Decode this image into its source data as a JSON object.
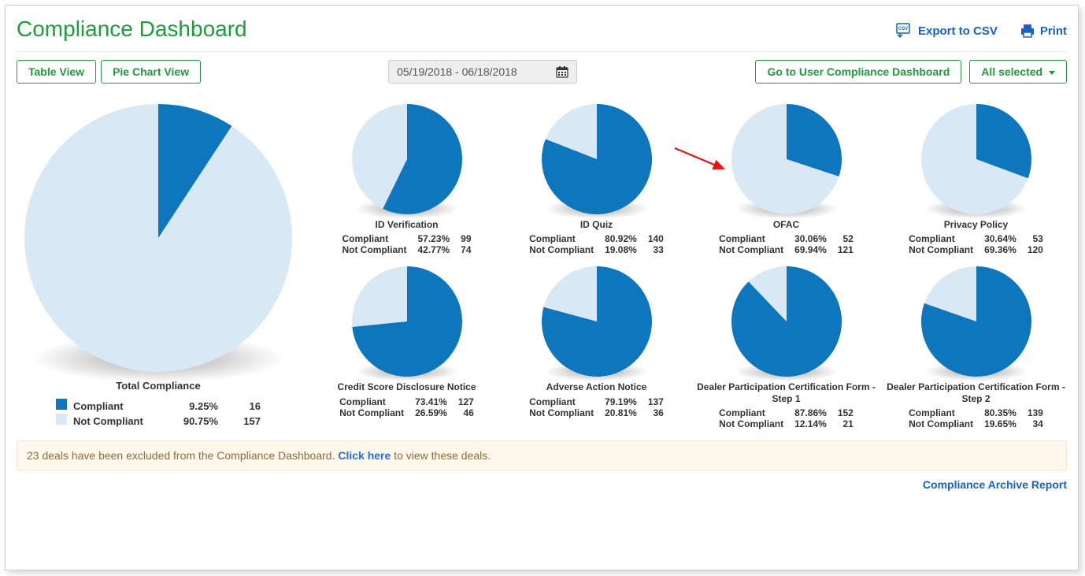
{
  "colors": {
    "compliant": "#0e76bc",
    "not_compliant": "#d8e9f5",
    "green": "#1b9e3a",
    "link": "#1862c6"
  },
  "header": {
    "title": "Compliance Dashboard",
    "export_csv": "Export to CSV",
    "print": "Print"
  },
  "controls": {
    "table_view": "Table View",
    "pie_chart_view": "Pie Chart View",
    "date_range": "05/19/2018 - 06/18/2018",
    "user_dashboard": "Go to User Compliance Dashboard",
    "all_selected": "All selected"
  },
  "legend": {
    "compliant": "Compliant",
    "not_compliant": "Not Compliant"
  },
  "total": {
    "title": "Total Compliance",
    "compliant_pct": "9.25%",
    "compliant_n": "16",
    "not_pct": "90.75%",
    "not_n": "157"
  },
  "cards": [
    {
      "title": "ID Verification",
      "compliant_pct": "57.23%",
      "compliant_n": "99",
      "not_pct": "42.77%",
      "not_n": "74"
    },
    {
      "title": "ID Quiz",
      "compliant_pct": "80.92%",
      "compliant_n": "140",
      "not_pct": "19.08%",
      "not_n": "33"
    },
    {
      "title": "OFAC",
      "compliant_pct": "30.06%",
      "compliant_n": "52",
      "not_pct": "69.94%",
      "not_n": "121"
    },
    {
      "title": "Privacy Policy",
      "compliant_pct": "30.64%",
      "compliant_n": "53",
      "not_pct": "69.36%",
      "not_n": "120"
    },
    {
      "title": "Credit Score Disclosure Notice",
      "compliant_pct": "73.41%",
      "compliant_n": "127",
      "not_pct": "26.59%",
      "not_n": "46"
    },
    {
      "title": "Adverse Action Notice",
      "compliant_pct": "79.19%",
      "compliant_n": "137",
      "not_pct": "20.81%",
      "not_n": "36"
    },
    {
      "title": "Dealer Participation Certification Form - Step 1",
      "compliant_pct": "87.86%",
      "compliant_n": "152",
      "not_pct": "12.14%",
      "not_n": "21"
    },
    {
      "title": "Dealer Participation Certification Form -  Step 2",
      "compliant_pct": "80.35%",
      "compliant_n": "139",
      "not_pct": "19.65%",
      "not_n": "34"
    }
  ],
  "banner": {
    "prefix": "23 deals have been excluded from the Compliance Dashboard. ",
    "link": "Click here",
    "suffix": " to view these deals."
  },
  "footer_link": "Compliance Archive Report",
  "chart_data": [
    {
      "type": "pie",
      "title": "Total Compliance",
      "series": [
        {
          "name": "Compliant",
          "value": 16,
          "pct": 9.25
        },
        {
          "name": "Not Compliant",
          "value": 157,
          "pct": 90.75
        }
      ]
    },
    {
      "type": "pie",
      "title": "ID Verification",
      "series": [
        {
          "name": "Compliant",
          "value": 99,
          "pct": 57.23
        },
        {
          "name": "Not Compliant",
          "value": 74,
          "pct": 42.77
        }
      ]
    },
    {
      "type": "pie",
      "title": "ID Quiz",
      "series": [
        {
          "name": "Compliant",
          "value": 140,
          "pct": 80.92
        },
        {
          "name": "Not Compliant",
          "value": 33,
          "pct": 19.08
        }
      ]
    },
    {
      "type": "pie",
      "title": "OFAC",
      "series": [
        {
          "name": "Compliant",
          "value": 52,
          "pct": 30.06
        },
        {
          "name": "Not Compliant",
          "value": 121,
          "pct": 69.94
        }
      ]
    },
    {
      "type": "pie",
      "title": "Privacy Policy",
      "series": [
        {
          "name": "Compliant",
          "value": 53,
          "pct": 30.64
        },
        {
          "name": "Not Compliant",
          "value": 120,
          "pct": 69.36
        }
      ]
    },
    {
      "type": "pie",
      "title": "Credit Score Disclosure Notice",
      "series": [
        {
          "name": "Compliant",
          "value": 127,
          "pct": 73.41
        },
        {
          "name": "Not Compliant",
          "value": 46,
          "pct": 26.59
        }
      ]
    },
    {
      "type": "pie",
      "title": "Adverse Action Notice",
      "series": [
        {
          "name": "Compliant",
          "value": 137,
          "pct": 79.19
        },
        {
          "name": "Not Compliant",
          "value": 36,
          "pct": 20.81
        }
      ]
    },
    {
      "type": "pie",
      "title": "Dealer Participation Certification Form - Step 1",
      "series": [
        {
          "name": "Compliant",
          "value": 152,
          "pct": 87.86
        },
        {
          "name": "Not Compliant",
          "value": 21,
          "pct": 12.14
        }
      ]
    },
    {
      "type": "pie",
      "title": "Dealer Participation Certification Form - Step 2",
      "series": [
        {
          "name": "Compliant",
          "value": 139,
          "pct": 80.35
        },
        {
          "name": "Not Compliant",
          "value": 34,
          "pct": 19.65
        }
      ]
    }
  ]
}
